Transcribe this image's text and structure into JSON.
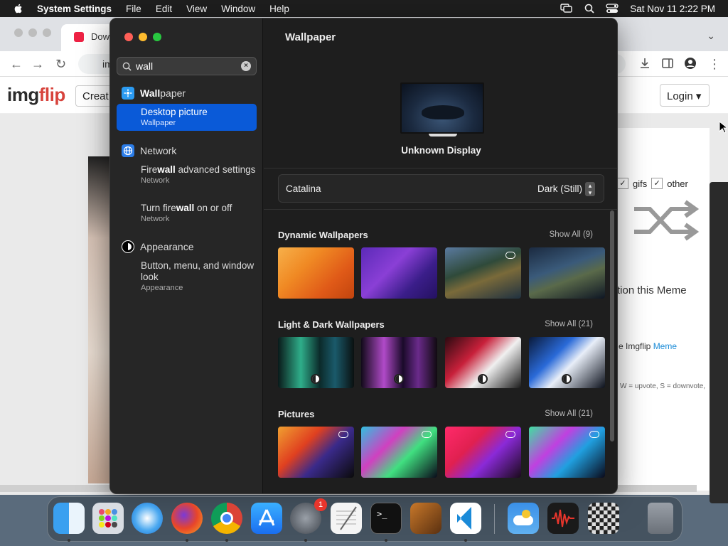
{
  "menubar": {
    "app_name": "System Settings",
    "items": [
      "File",
      "Edit",
      "View",
      "Window",
      "Help"
    ],
    "datetime": "Sat Nov 11  2:22 PM"
  },
  "browser": {
    "tab_title": "Dow",
    "url_text": "im",
    "logo_main": "img",
    "logo_accent": "flip",
    "create_label": "Creat",
    "login_label": "Login",
    "filters": {
      "gifs": "gifs",
      "other": "other"
    },
    "caption_text": "tion this Meme",
    "imgflip_meme_prefix": "e Imgflip ",
    "imgflip_meme_link": "Meme",
    "hint": "W = upvote, S = downvote,"
  },
  "settings": {
    "search_value": "wall",
    "groups": [
      {
        "label_pre": "",
        "label_hl": "Wall",
        "label_post": "paper",
        "icon": "wallpaper-icon",
        "color": "#2b9bf2"
      },
      {
        "label": "Network",
        "icon": "network-globe-icon",
        "color": "#2b7de9"
      },
      {
        "label": "Appearance",
        "icon": "appearance-icon",
        "color": "#ffffff"
      }
    ],
    "results": {
      "desktop_picture": {
        "title": "Desktop picture",
        "sub": "Wallpaper"
      },
      "firewall_advanced": {
        "pre": "Fire",
        "hl": "wall",
        "post": " advanced settings",
        "sub": "Network"
      },
      "turn_firewall": {
        "pre": "Turn fire",
        "hl": "wall",
        "post": " on or off",
        "sub": "Network"
      },
      "button_menu": {
        "title": "Button, menu, and window look",
        "sub": "Appearance"
      }
    },
    "main_title": "Wallpaper",
    "display_name": "Unknown Display",
    "wallpaper_name": "Catalina",
    "wallpaper_mode": "Dark (Still)",
    "sections": [
      {
        "title": "Dynamic Wallpapers",
        "show_all": "Show All (9)"
      },
      {
        "title": "Light & Dark Wallpapers",
        "show_all": "Show All (21)"
      },
      {
        "title": "Pictures",
        "show_all": "Show All (21)"
      }
    ]
  },
  "dock": {
    "apps": [
      "Finder",
      "Launchpad",
      "Safari",
      "Firefox",
      "Chrome",
      "App Store",
      "System Settings",
      "TextEdit",
      "Terminal",
      "GarageBand",
      "Visual Studio Code",
      "Weather",
      "Voice Memos",
      "Chess",
      "Trash"
    ],
    "settings_badge": "1"
  }
}
